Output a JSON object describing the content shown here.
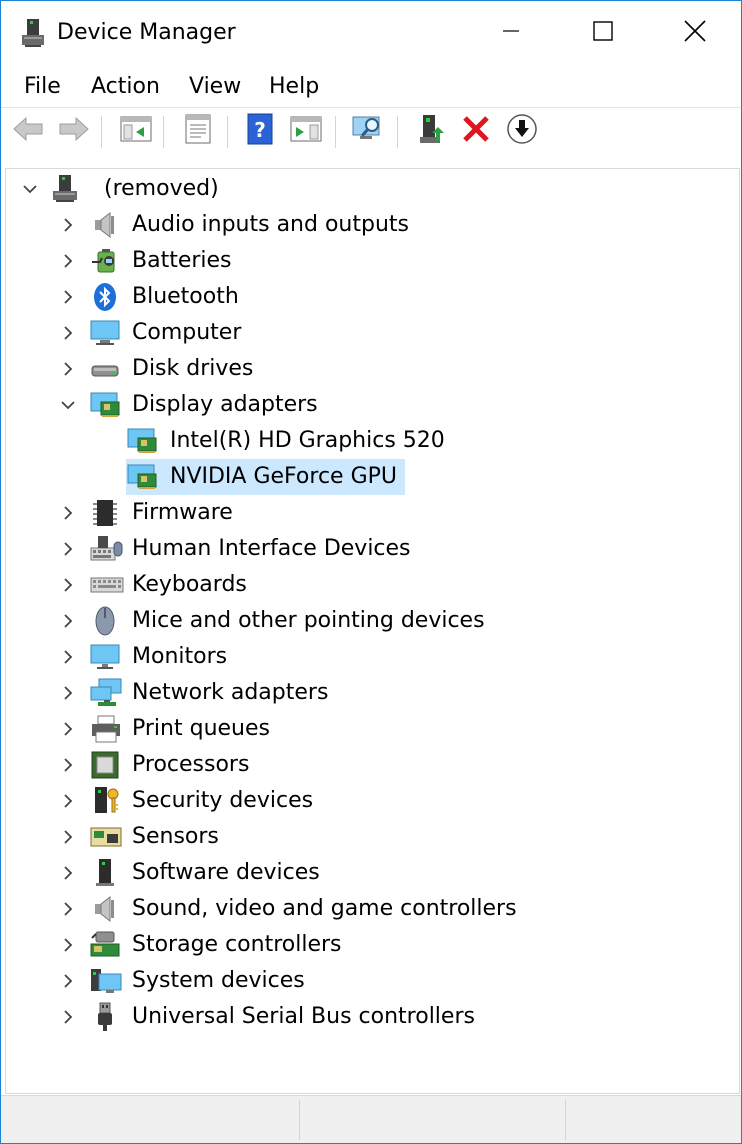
{
  "window": {
    "title": "Device Manager"
  },
  "title_buttons": {
    "minimize": "minimize-icon",
    "maximize": "maximize-icon",
    "close": "close-icon"
  },
  "menu": [
    "File",
    "Action",
    "View",
    "Help"
  ],
  "toolbar": {
    "buttons": [
      "back-icon",
      "forward-icon",
      "show-hide-console-tree-icon",
      "properties-icon",
      "help-icon",
      "action-pane-icon",
      "scan-hardware-icon",
      "update-driver-icon",
      "uninstall-device-icon",
      "disable-device-icon"
    ],
    "accent_red": "#e0161e",
    "accent_blue": "#2b63d6"
  },
  "tree": {
    "root_label": "(removed)",
    "categories": [
      {
        "label": "Audio inputs and outputs",
        "icon": "speaker-icon"
      },
      {
        "label": "Batteries",
        "icon": "battery-icon"
      },
      {
        "label": "Bluetooth",
        "icon": "bluetooth-icon"
      },
      {
        "label": "Computer",
        "icon": "computer-icon"
      },
      {
        "label": "Disk drives",
        "icon": "disk-drive-icon"
      },
      {
        "label": "Display adapters",
        "icon": "display-adapter-icon",
        "expanded": true,
        "children": [
          {
            "label": "Intel(R) HD Graphics 520",
            "icon": "display-adapter-icon"
          },
          {
            "label": "NVIDIA GeForce GPU",
            "icon": "display-adapter-icon",
            "selected": true
          }
        ]
      },
      {
        "label": "Firmware",
        "icon": "firmware-chip-icon"
      },
      {
        "label": "Human Interface Devices",
        "icon": "hid-icon"
      },
      {
        "label": "Keyboards",
        "icon": "keyboard-icon"
      },
      {
        "label": "Mice and other pointing devices",
        "icon": "mouse-icon"
      },
      {
        "label": "Monitors",
        "icon": "monitor-icon"
      },
      {
        "label": "Network adapters",
        "icon": "network-adapter-icon"
      },
      {
        "label": "Print queues",
        "icon": "printer-icon"
      },
      {
        "label": "Processors",
        "icon": "processor-icon"
      },
      {
        "label": "Security devices",
        "icon": "security-key-icon"
      },
      {
        "label": "Sensors",
        "icon": "sensor-icon"
      },
      {
        "label": "Software devices",
        "icon": "software-device-icon"
      },
      {
        "label": "Sound, video and game controllers",
        "icon": "speaker-icon"
      },
      {
        "label": "Storage controllers",
        "icon": "storage-controller-icon"
      },
      {
        "label": "System devices",
        "icon": "system-devices-icon"
      },
      {
        "label": "Universal Serial Bus controllers",
        "icon": "usb-icon"
      }
    ]
  },
  "colors": {
    "selection": "#cce8ff",
    "border_accent": "#1883d7",
    "status_bg": "#f0f0f0"
  }
}
